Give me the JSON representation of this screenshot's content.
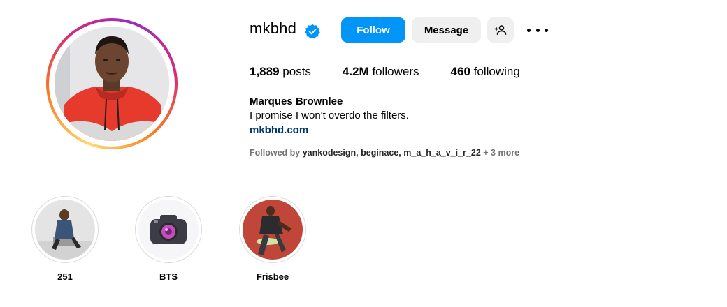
{
  "profile": {
    "username": "mkbhd",
    "verified": true,
    "follow_label": "Follow",
    "message_label": "Message",
    "stats": [
      {
        "count": "1,889",
        "label": "posts"
      },
      {
        "count": "4.2M",
        "label": "followers"
      },
      {
        "count": "460",
        "label": "following"
      }
    ],
    "full_name": "Marques Brownlee",
    "bio": "I promise I won't overdo the filters.",
    "website": "mkbhd.com",
    "followed_by": {
      "prefix": "Followed by",
      "users": [
        "yankodesign",
        "beginace",
        "m_a_h_a_v_i_r_22"
      ],
      "suffix": "+ 3 more"
    }
  },
  "highlights": [
    {
      "label": "251"
    },
    {
      "label": "BTS"
    },
    {
      "label": "Frisbee"
    }
  ],
  "colors": {
    "accent": "#0095f6",
    "button_secondary": "#efefef",
    "link": "#00376b",
    "muted": "#737373"
  }
}
